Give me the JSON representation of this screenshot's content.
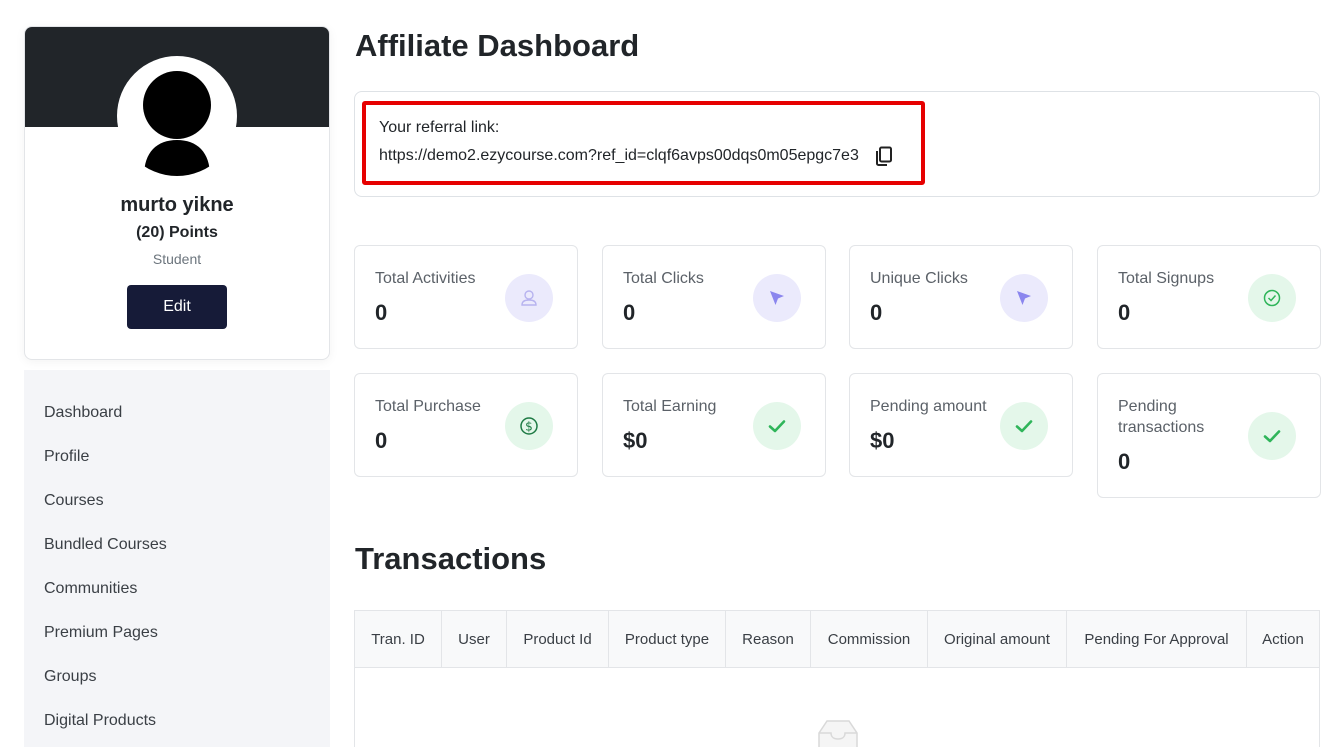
{
  "profile": {
    "name": "murto yikne",
    "points": "(20) Points",
    "role": "Student",
    "edit_label": "Edit"
  },
  "sidebar": {
    "items": [
      {
        "label": "Dashboard"
      },
      {
        "label": "Profile"
      },
      {
        "label": "Courses"
      },
      {
        "label": "Bundled Courses"
      },
      {
        "label": "Communities"
      },
      {
        "label": "Premium Pages"
      },
      {
        "label": "Groups"
      },
      {
        "label": "Digital Products"
      }
    ]
  },
  "main": {
    "title": "Affiliate Dashboard",
    "referral": {
      "label": "Your referral link:",
      "link": "https://demo2.ezycourse.com?ref_id=clqf6avps00dqs0m05epgc7e3"
    },
    "stats": [
      {
        "label": "Total Activities",
        "value": "0",
        "icon": "user-icon"
      },
      {
        "label": "Total Clicks",
        "value": "0",
        "icon": "cursor-icon"
      },
      {
        "label": "Unique Clicks",
        "value": "0",
        "icon": "cursor-icon"
      },
      {
        "label": "Total Signups",
        "value": "0",
        "icon": "check-circle-icon"
      },
      {
        "label": "Total Purchase",
        "value": "0",
        "icon": "dollar-icon"
      },
      {
        "label": "Total Earning",
        "value": "$0",
        "icon": "check-icon"
      },
      {
        "label": "Pending amount",
        "value": "$0",
        "icon": "check-icon"
      },
      {
        "label": "Pending transactions",
        "value": "0",
        "icon": "check-icon"
      }
    ],
    "transactions": {
      "title": "Transactions",
      "columns": [
        "Tran. ID",
        "User",
        "Product Id",
        "Product type",
        "Reason",
        "Commission",
        "Original amount",
        "Pending For Approval",
        "Action"
      ]
    }
  },
  "colors": {
    "banner": "#212529",
    "edit_button": "#161b38",
    "highlight": "#e60000",
    "purple_icon": "#8b86ee",
    "green_icon": "#2fb55a"
  }
}
